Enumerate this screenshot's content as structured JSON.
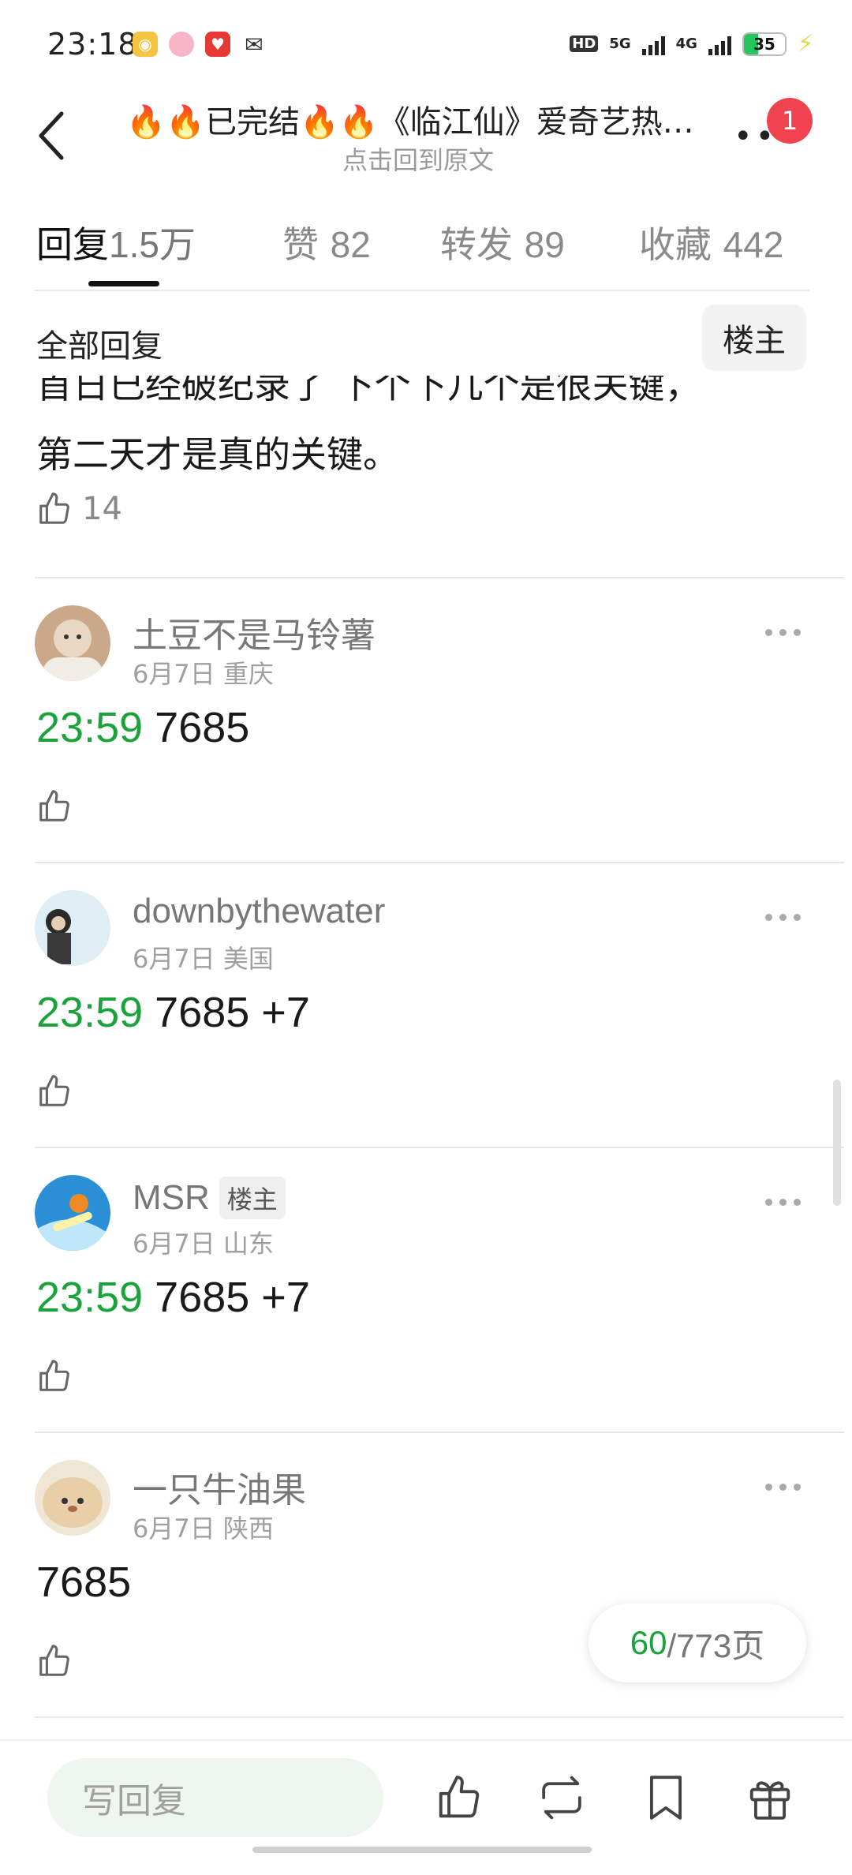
{
  "status_bar": {
    "time": "23:18",
    "network_hd": "HD",
    "network_5g": "5G",
    "network_4g": "4G",
    "battery_level": "35",
    "battery_fraction": 0.35
  },
  "header": {
    "title": "🔥🔥已完结🔥🔥《临江仙》爱奇艺热…",
    "subtitle": "点击回到原文",
    "notification_count": "1"
  },
  "tabs": [
    {
      "label": "回复",
      "count": "1.5万",
      "active": true
    },
    {
      "label": "赞",
      "count": "82",
      "active": false
    },
    {
      "label": "转发",
      "count": "89",
      "active": false
    },
    {
      "label": "收藏",
      "count": "442",
      "active": false
    }
  ],
  "filter": {
    "all_replies": "全部回复",
    "owner_only": "楼主"
  },
  "first_comment": {
    "clipped_line": "首日已经破纪录了 下个下几个是很关键，",
    "line2": "第二天才是真的关键。",
    "likes": "14"
  },
  "comments": [
    {
      "username": "土豆不是马铃薯",
      "badge": "",
      "date": "6月7日",
      "location": "重庆",
      "timestamp": "23:59",
      "text": "7685",
      "avatar_color": "#c9a98a"
    },
    {
      "username": "downbythewater",
      "badge": "",
      "date": "6月7日",
      "location": "美国",
      "timestamp": "23:59",
      "text": "7685 +7",
      "avatar_color": "#dfeef5"
    },
    {
      "username": "MSR",
      "badge": "楼主",
      "date": "6月7日",
      "location": "山东",
      "timestamp": "23:59",
      "text": "7685 +7",
      "avatar_color": "#2b8fd6"
    },
    {
      "username": "一只牛油果",
      "badge": "",
      "date": "6月7日",
      "location": "陕西",
      "timestamp": "",
      "text": "7685",
      "avatar_color": "#e8d3b4"
    }
  ],
  "pagination": {
    "current": "60",
    "total": "/773页"
  },
  "bottom_bar": {
    "reply_placeholder": "写回复",
    "icons": [
      "thumb-up-icon",
      "repost-icon",
      "bookmark-icon",
      "gift-icon"
    ]
  },
  "colors": {
    "accent_green": "#1aa33a",
    "notification_red": "#f0424f"
  }
}
